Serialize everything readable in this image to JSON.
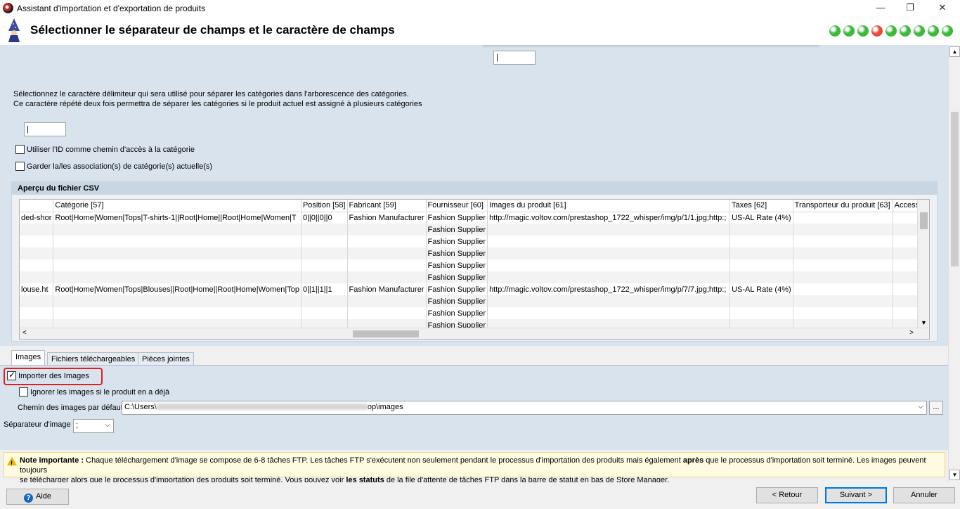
{
  "window": {
    "title": "Assistant d'importation et d'exportation de produits",
    "minimize": "—",
    "restore": "❐",
    "close": "✕"
  },
  "header": {
    "title": "Sélectionner le séparateur de champs et le caractère de champs",
    "step_colors": [
      "#3cb83c",
      "#3cb83c",
      "#3cb83c",
      "#e84b3c",
      "#3cb83c",
      "#3cb83c",
      "#3cb83c",
      "#3cb83c",
      "#3cb83c"
    ]
  },
  "category": {
    "description_line1": "Sélectionnez le caractère délimiteur qui sera utilisé pour séparer les catégories dans l'arborescence des catégories.",
    "description_line2": "Ce caractère répété deux fois permettra de séparer les catégories si le produit actuel est assigné à plusieurs catégories",
    "top_input_value": "|",
    "delimiter_value": "|",
    "use_id_label": "Utiliser l'ID comme chemin d'accès à la catégorie",
    "keep_assoc_label": "Garder la/les association(s) de catégorie(s) actuelle(s)"
  },
  "csv_preview": {
    "title": "Aperçu du fichier CSV",
    "columns": [
      "",
      "Catégorie [57]",
      "Position [58]",
      "Fabricant [59]",
      "Fournisseur [60]",
      "Images du produit [61]",
      "Taxes [62]",
      "Transporteur du produit [63]",
      "Accesso"
    ],
    "rows": [
      [
        "ded-shor",
        "Root|Home|Women|Tops|T-shirts-1||Root|Home||Root|Home|Women|T",
        "0||0||0||0",
        "Fashion Manufacturer",
        "Fashion Supplier",
        "http://magic.voltov.com/prestashop_1722_whisper/img/p/1/1.jpg;http:;",
        "US-AL Rate (4%)",
        "",
        ""
      ],
      [
        "",
        "",
        "",
        "",
        "Fashion Supplier",
        "",
        "",
        "",
        ""
      ],
      [
        "",
        "",
        "",
        "",
        "Fashion Supplier",
        "",
        "",
        "",
        ""
      ],
      [
        "",
        "",
        "",
        "",
        "Fashion Supplier",
        "",
        "",
        "",
        ""
      ],
      [
        "",
        "",
        "",
        "",
        "Fashion Supplier",
        "",
        "",
        "",
        ""
      ],
      [
        "",
        "",
        "",
        "",
        "Fashion Supplier",
        "",
        "",
        "",
        ""
      ],
      [
        "louse.ht",
        "Root|Home|Women|Tops|Blouses||Root|Home||Root|Home|Women|Top",
        "0||1||1||1",
        "Fashion Manufacturer",
        "Fashion Supplier",
        "http://magic.voltov.com/prestashop_1722_whisper/img/p/7/7.jpg;http:;",
        "US-AL Rate (4%)",
        "",
        ""
      ],
      [
        "",
        "",
        "",
        "",
        "Fashion Supplier",
        "",
        "",
        "",
        ""
      ],
      [
        "",
        "",
        "",
        "",
        "Fashion Supplier",
        "",
        "",
        "",
        ""
      ],
      [
        "",
        "",
        "",
        "",
        "Fashion Supplier",
        "",
        "",
        "",
        ""
      ]
    ]
  },
  "tabs": [
    "Images",
    "Fichiers téléchargeables",
    "Pièces jointes"
  ],
  "images": {
    "import_label": "Importer des Images",
    "skip_label": "Ignorer les images si le produit en a déjà",
    "path_label": "Chemin des images par défaut",
    "path_prefix": "C:\\Users\\",
    "path_suffix": "op\\images",
    "browse": "...",
    "separator_label": "Séparateur d'image",
    "separator_value": ";"
  },
  "note": {
    "bold_prefix": "Note importante :",
    "text1": " Chaque téléchargement d'image se compose de 6-8 tâches FTP. Les tâches FTP s'exécutent non seulement pendant le processus d'importation des produits mais également ",
    "bold_after": "après",
    "text2": " que le processus d'importation soit terminé. Les images peuvent toujours",
    "text3": "se télécharger alors que le processus d'importation des produits soit terminé. Vous pouvez voir ",
    "bold_status": "les statuts",
    "text4": " de la file d'attente de tâches FTP dans la barre de statut en bas de Store Manager."
  },
  "footer": {
    "help": "Aide",
    "back": "< Retour",
    "next": "Suivant >",
    "cancel": "Annuler"
  }
}
